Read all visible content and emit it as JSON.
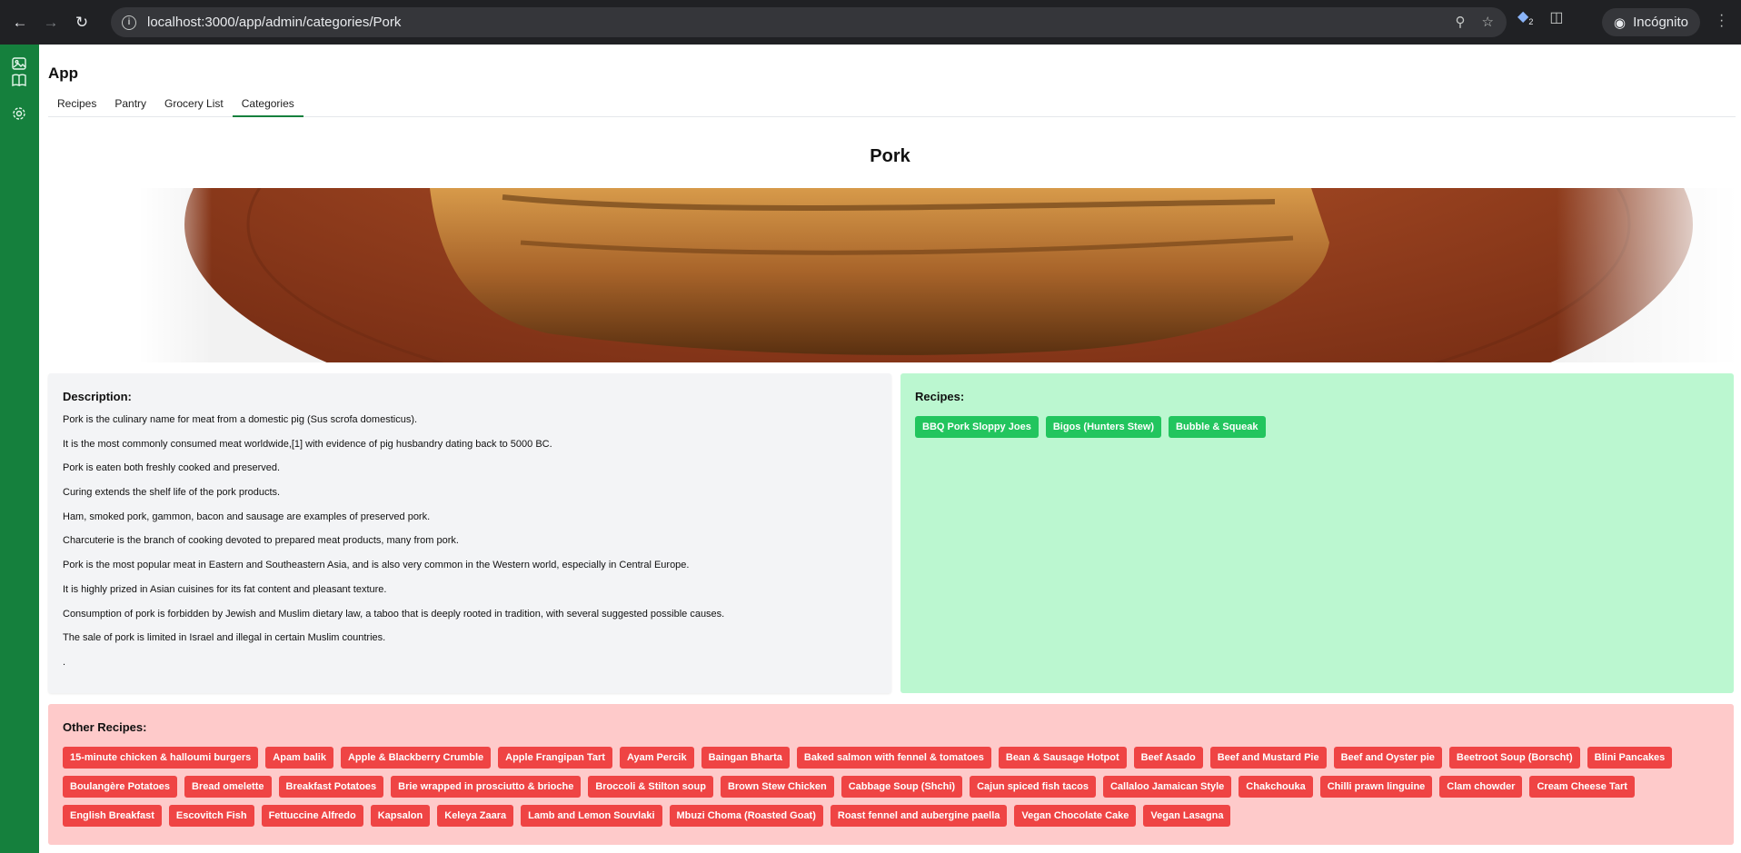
{
  "browser": {
    "url": "localhost:3000/app/admin/categories/Pork",
    "incognito_label": "Incógnito",
    "extension_badge": "2"
  },
  "app": {
    "title": "App",
    "tabs": [
      "Recipes",
      "Pantry",
      "Grocery List",
      "Categories"
    ],
    "active_tab": "Categories"
  },
  "sidebar": {
    "icons": [
      "image-icon",
      "book-icon",
      "settings-icon"
    ]
  },
  "category": {
    "name": "Pork",
    "description_heading": "Description:",
    "description_lines": [
      "Pork is the culinary name for meat from a domestic pig (Sus scrofa domesticus).",
      "It is the most commonly consumed meat worldwide,[1] with evidence of pig husbandry dating back to 5000 BC.",
      "Pork is eaten both freshly cooked and preserved.",
      "Curing extends the shelf life of the pork products.",
      "Ham, smoked pork, gammon, bacon and sausage are examples of preserved pork.",
      "Charcuterie is the branch of cooking devoted to prepared meat products, many from pork.",
      "Pork is the most popular meat in Eastern and Southeastern Asia, and is also very common in the Western world, especially in Central Europe.",
      "It is highly prized in Asian cuisines for its fat content and pleasant texture.",
      "Consumption of pork is forbidden by Jewish and Muslim dietary law, a taboo that is deeply rooted in tradition, with several suggested possible causes.",
      "The sale of pork is limited in Israel and illegal in certain Muslim countries.",
      "."
    ],
    "recipes_heading": "Recipes:",
    "recipes": [
      "BBQ Pork Sloppy Joes",
      "Bigos (Hunters Stew)",
      "Bubble & Squeak"
    ],
    "other_heading": "Other Recipes:",
    "other_recipes": [
      "15-minute chicken & halloumi burgers",
      "Apam balik",
      "Apple & Blackberry Crumble",
      "Apple Frangipan Tart",
      "Ayam Percik",
      "Baingan Bharta",
      "Baked salmon with fennel & tomatoes",
      "Bean & Sausage Hotpot",
      "Beef Asado",
      "Beef and Mustard Pie",
      "Beef and Oyster pie",
      "Beetroot Soup (Borscht)",
      "Blini Pancakes",
      "Boulangère Potatoes",
      "Bread omelette",
      "Breakfast Potatoes",
      "Brie wrapped in prosciutto & brioche",
      "Broccoli & Stilton soup",
      "Brown Stew Chicken",
      "Cabbage Soup (Shchi)",
      "Cajun spiced fish tacos",
      "Callaloo Jamaican Style",
      "Chakchouka",
      "Chilli prawn linguine",
      "Clam chowder",
      "Cream Cheese Tart",
      "English Breakfast",
      "Escovitch Fish",
      "Fettuccine Alfredo",
      "Kapsalon",
      "Keleya Zaara",
      "Lamb and Lemon Souvlaki",
      "Mbuzi Choma (Roasted Goat)",
      "Roast fennel and aubergine paella",
      "Vegan Chocolate Cake",
      "Vegan Lasagna"
    ]
  },
  "colors": {
    "sidebar": "#15803d",
    "recipe_chip": "#22c55e",
    "other_chip": "#ef4444",
    "recipes_panel": "#bbf7d0",
    "other_panel": "#fecaca",
    "description_panel": "#f3f4f6"
  }
}
